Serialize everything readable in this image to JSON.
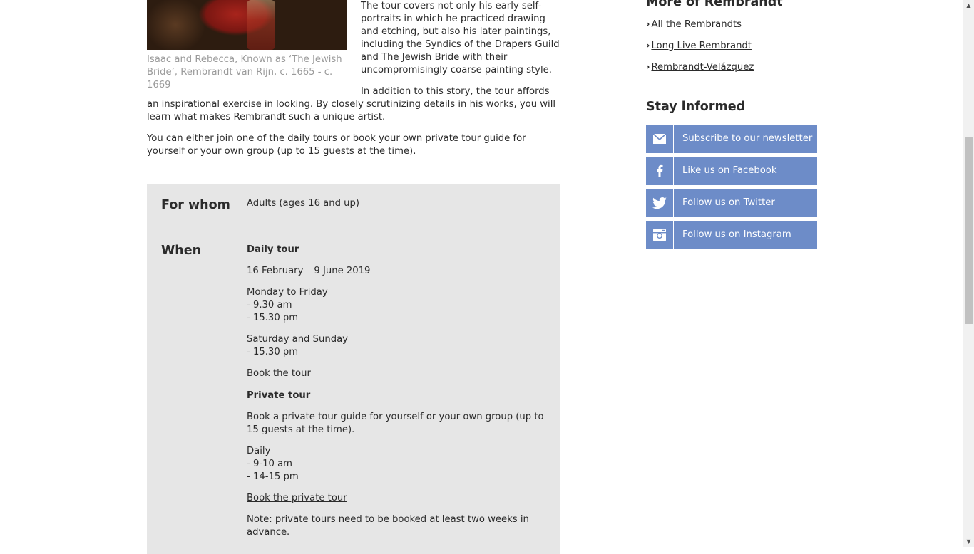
{
  "article": {
    "image_alt": "Isaac and Rebecca painting",
    "caption": "Isaac and Rebecca, Known as ‘The Jewish Bride’, Rembrandt van Rijn, c. 1665 - c. 1669",
    "paragraph1": "The tour covers not only his early self-portraits in which he practiced drawing and etching, but also his later paintings, including the Syndics of the Drapers Guild and The Jewish Bride with their uncompromisingly coarse painting style.",
    "paragraph2": "In addition to this story, the tour affords an inspirational exercise in looking. By closely scrutinizing details in his works, you will learn what makes Rembrandt such a unique artist.",
    "paragraph3": "You can either join one of the daily tours or book your own private tour guide for yourself or your own group (up to 15 guests at the time)."
  },
  "info": {
    "for_whom_label": "For whom",
    "for_whom_value": "Adults (ages 16 and up)",
    "when_label": "When",
    "daily_title": "Daily tour",
    "daily_dates": "16 February – 9 June 2019",
    "weekday_label": "Monday to Friday",
    "weekday_time1": "- 9.30 am",
    "weekday_time2": "- 15.30 pm",
    "weekend_label": "Saturday and Sunday",
    "weekend_time1": "- 15.30 pm",
    "book_tour_link": "Book the tour",
    "private_title": "Private tour",
    "private_desc": "Book a private tour guide for yourself or your own group (up to 15 guests at the time).",
    "private_daily": "Daily",
    "private_time1": "- 9-10 am",
    "private_time2": "- 14-15 pm",
    "book_private_link": "Book the private tour",
    "note": "Note: private tours need to be booked at least two weeks in advance."
  },
  "sidebar": {
    "more_heading": "More of Rembrandt",
    "links": [
      {
        "label": "All the Rembrandts"
      },
      {
        "label": "Long Live Rembrandt"
      },
      {
        "label": "Rembrandt-Velázquez"
      }
    ],
    "stay_heading": "Stay informed",
    "social": [
      {
        "label": "Subscribe to our newsletter",
        "icon": "envelope-icon"
      },
      {
        "label": "Like us on Facebook",
        "icon": "facebook-icon"
      },
      {
        "label": "Follow us on Twitter",
        "icon": "twitter-icon"
      },
      {
        "label": "Follow us on Instagram",
        "icon": "instagram-icon"
      }
    ],
    "button_color": "#6d8cc8"
  }
}
